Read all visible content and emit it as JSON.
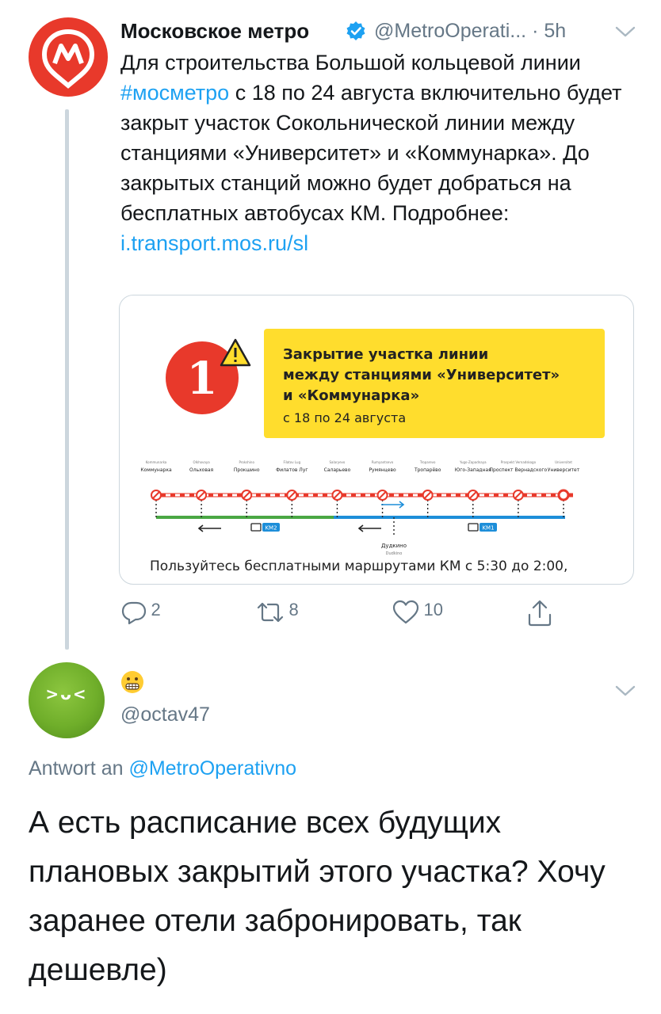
{
  "tweet": {
    "author_name": "Московское метро",
    "handle": "@MetroOperati...",
    "time": "· 5h",
    "text_before_hashtag": "Для строительства Большой кольцевой линии ",
    "hashtag": "#мосметро",
    "text_after_hashtag": " с 18 по 24 августа включительно будет закрыт участок Сокольнической линии между станциями «Университет» и «Коммунарка». До закрытых станций можно будет добраться на бесплатных автобусах КМ. Подробнее: ",
    "link": "i.transport.mos.ru/sl",
    "logo_letter": "M"
  },
  "card": {
    "line_number": "1",
    "banner_line1": "Закрытие участка линии",
    "banner_line2": "между станциями «Университет»",
    "banner_line3": "и «Коммунарка»",
    "banner_dates": "с 18 по 24 августа",
    "stations": [
      {
        "latin": "Kommunarka",
        "name": "Коммунарка"
      },
      {
        "latin": "Olkhovaya",
        "name": "Ольховая"
      },
      {
        "latin": "Prokshino",
        "name": "Прокшино"
      },
      {
        "latin": "Filatov Lug",
        "name": "Филатов Луг"
      },
      {
        "latin": "Salaryevo",
        "name": "Саларьево"
      },
      {
        "latin": "Rumyantsevo",
        "name": "Румянцево"
      },
      {
        "latin": "Troparevo",
        "name": "Тропарёво"
      },
      {
        "latin": "Yugo-Zapadnaya",
        "name": "Юго-Западная"
      },
      {
        "latin": "Prospekt Vernadskogo",
        "name": "Проспект Вернадского"
      },
      {
        "latin": "Universitet",
        "name": "Университет"
      }
    ],
    "bus_km2": "KM2",
    "bus_km1": "KM1",
    "transfer_station": "Дудкино",
    "transfer_station_latin": "Dudkino",
    "footer": "Пользуйтесь бесплатными маршрутами КМ с 5:30 до 2:00,",
    "colors": {
      "line_red": "#e8392b",
      "banner_yellow": "#ffdd2d",
      "route_green": "#4aa744",
      "route_blue": "#1d8ed9"
    }
  },
  "actions": {
    "replies": "2",
    "retweets": "8",
    "likes": "10"
  },
  "reply": {
    "handle": "@octav47",
    "emoji": "grimacing-face",
    "reply_to_prefix": "Antwort an ",
    "reply_to_handle": "@MetroOperativno",
    "text": "А есть расписание всех будущих плановых закрытий этого участка? Хочу заранее отели забронировать, так дешевле)",
    "avatar_face": ">ᴗ<"
  }
}
